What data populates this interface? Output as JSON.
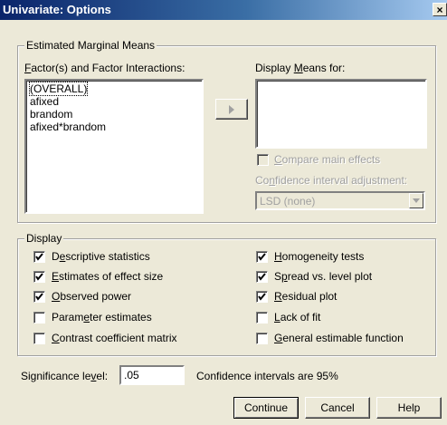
{
  "window": {
    "title": "Univariate: Options",
    "close_glyph": "×"
  },
  "estimated_marginal_means": {
    "legend": "Estimated Marginal Means",
    "factors_label": "Factor(s) and Factor Interactions:",
    "factors": [
      "(OVERALL)",
      "afixed",
      "brandom",
      "afixed*brandom"
    ],
    "display_means_label": "Display Means for:",
    "compare_main_effects": {
      "label": "Compare main effects",
      "checked": false,
      "enabled": false
    },
    "ci_adjustment_label": "Confidence interval adjustment:",
    "ci_adjustment_value": "LSD (none)"
  },
  "display": {
    "legend": "Display",
    "left": [
      {
        "label": "Descriptive statistics",
        "checked": true
      },
      {
        "label": "Estimates of effect size",
        "checked": true
      },
      {
        "label": "Observed power",
        "checked": true
      },
      {
        "label": "Parameter estimates",
        "checked": false
      },
      {
        "label": "Contrast coefficient matrix",
        "checked": false
      }
    ],
    "right": [
      {
        "label": "Homogeneity tests",
        "checked": true
      },
      {
        "label": "Spread vs. level plot",
        "checked": true
      },
      {
        "label": "Residual plot",
        "checked": true
      },
      {
        "label": "Lack of fit",
        "checked": false
      },
      {
        "label": "General estimable function",
        "checked": false
      }
    ]
  },
  "significance": {
    "label": "Significance level:",
    "value": ".05",
    "ci_text": "Confidence intervals are 95%"
  },
  "buttons": {
    "continue": "Continue",
    "cancel": "Cancel",
    "help": "Help"
  }
}
